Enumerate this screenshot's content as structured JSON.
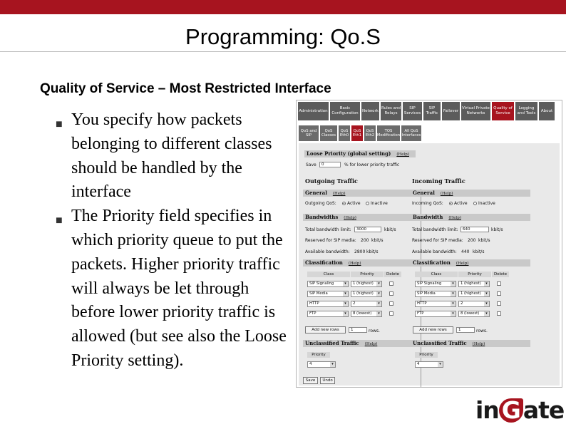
{
  "slide": {
    "title": "Programming: Qo.S",
    "subtitle": "Quality of Service – Most Restricted Interface",
    "bullets": [
      "You specify how packets belonging to different classes should be handled by the interface",
      "The Priority field specifies in which priority queue to put the packets. Higher priority traffic will always be let through before lower priority traffic is allowed (but see also the Loose Priority setting)."
    ],
    "logo": {
      "pre": "in",
      "mid": "G",
      "post": "ate"
    }
  },
  "nav": {
    "items": [
      {
        "label": "Administration"
      },
      {
        "label": "Basic Configuration"
      },
      {
        "label": "Network"
      },
      {
        "label": "Rules and Relays"
      },
      {
        "label": "SIP Services"
      },
      {
        "label": "SIP Traffic"
      },
      {
        "label": "Failover"
      },
      {
        "label": "Virtual Private Networks"
      },
      {
        "label": "Quality of Service"
      },
      {
        "label": "Logging and Tools"
      },
      {
        "label": "About"
      }
    ],
    "subtabs": [
      {
        "label": "QoS and SIP"
      },
      {
        "label": "QoS Classes"
      },
      {
        "label": "QoS Eth0"
      },
      {
        "label": "QoS Eth1"
      },
      {
        "label": "QoS Eth2"
      },
      {
        "label": "TOS Modification"
      },
      {
        "label": "All QoS Interfaces"
      }
    ]
  },
  "loose": {
    "header": "Loose Priority (global setting)",
    "help": "(Help)",
    "save_label": "Save",
    "save_value": "0",
    "suffix": "% for lower priority traffic"
  },
  "outgoing": {
    "heading": "Outgoing Traffic",
    "general_header": "General",
    "qos_label": "Outgoing QoS:",
    "active": "Active",
    "inactive": "Inactive",
    "bandwidth_header": "Bandwidths",
    "total_label": "Total bandwidth limit:",
    "total_value": "3000",
    "unit": "kbit/s",
    "reserved_label": "Reserved for SIP media:",
    "reserved_value": "200",
    "available_label": "Available bandwidth:",
    "available_value": "2800",
    "classification_header": "Classification",
    "col_class": "Class",
    "col_priority": "Priority",
    "col_delete": "Delete",
    "rows": [
      {
        "class": "SIP Signaling",
        "priority": "1 (highest)"
      },
      {
        "class": "SIP Media",
        "priority": "1 (highest)"
      },
      {
        "class": "HTTP",
        "priority": "2"
      },
      {
        "class": "FTP",
        "priority": "8 (lowest)"
      }
    ],
    "add_button": "Add new rows",
    "add_count": "1",
    "rows_label": "rows.",
    "unclassified_header": "Unclassified Traffic",
    "priority_label": "Priority",
    "priority_value": "4"
  },
  "incoming": {
    "heading": "Incoming Traffic",
    "general_header": "General",
    "qos_label": "Incoming QoS:",
    "active": "Active",
    "inactive": "Inactive",
    "bandwidth_header": "Bandwidth",
    "total_label": "Total bandwidth limit:",
    "total_value": "640",
    "unit": "kbit/s",
    "reserved_label": "Reserved for SIP media:",
    "reserved_value": "200",
    "available_label": "Available bandwidth:",
    "available_value": "440",
    "classification_header": "Classification",
    "col_class": "Class",
    "col_priority": "Priority",
    "col_delete": "Delete",
    "rows": [
      {
        "class": "SIP Signaling",
        "priority": "1 (highest)"
      },
      {
        "class": "SIP Media",
        "priority": "1 (highest)"
      },
      {
        "class": "HTTP",
        "priority": "2"
      },
      {
        "class": "FTP",
        "priority": "8 (lowest)"
      }
    ],
    "add_button": "Add new rows",
    "add_count": "1",
    "rows_label": "rows.",
    "unclassified_header": "Unclassified Traffic",
    "priority_label": "Priority",
    "priority_value": "4"
  },
  "footer": {
    "save": "Save",
    "undo": "Undo"
  },
  "colors": {
    "brand": "#a7141f",
    "nav": "#5c5c5c"
  }
}
